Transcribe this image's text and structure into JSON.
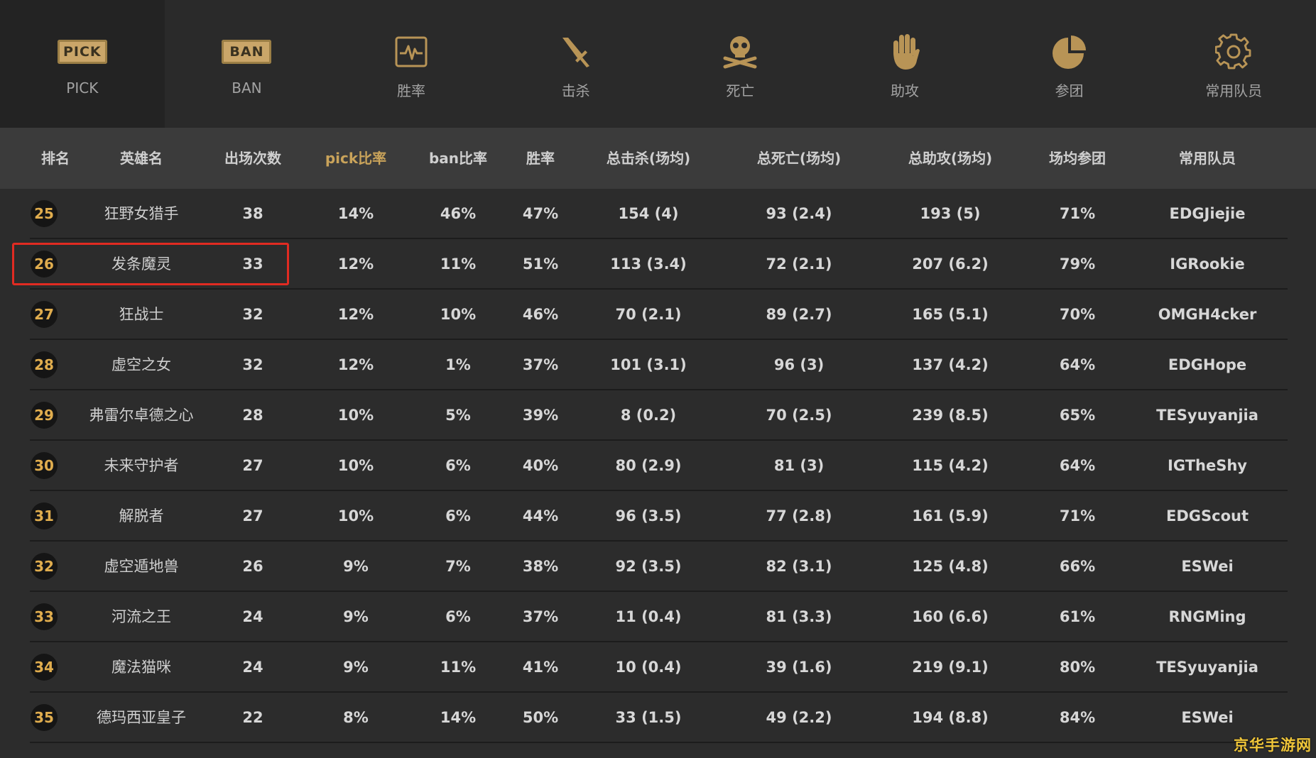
{
  "tabs": [
    {
      "label": "PICK",
      "icon": "pick-badge-icon",
      "badge": "PICK"
    },
    {
      "label": "BAN",
      "icon": "ban-badge-icon",
      "badge": "BAN"
    },
    {
      "label": "胜率",
      "icon": "pulse-chart-icon"
    },
    {
      "label": "击杀",
      "icon": "sword-icon"
    },
    {
      "label": "死亡",
      "icon": "skull-crossbones-icon"
    },
    {
      "label": "助攻",
      "icon": "hand-icon"
    },
    {
      "label": "参团",
      "icon": "pie-chart-icon"
    },
    {
      "label": "常用队员",
      "icon": "gear-icon"
    }
  ],
  "accent_color": "#c9a35a",
  "rank_color": "#e0ad4e",
  "highlight_color": "#e12b22",
  "columns": [
    "排名",
    "英雄名",
    "出场次数",
    "pick比率",
    "ban比率",
    "胜率",
    "总击杀(场均)",
    "总死亡(场均)",
    "总助攻(场均)",
    "场均参团",
    "常用队员"
  ],
  "rows": [
    {
      "rank": "25",
      "hero": "狂野女猎手",
      "games": "38",
      "pick": "14%",
      "ban": "46%",
      "win": "47%",
      "kills": "154 (4)",
      "deaths": "93 (2.4)",
      "assists": "193 (5)",
      "kp": "71%",
      "player": "EDGJiejie"
    },
    {
      "rank": "26",
      "hero": "发条魔灵",
      "games": "33",
      "pick": "12%",
      "ban": "11%",
      "win": "51%",
      "kills": "113 (3.4)",
      "deaths": "72 (2.1)",
      "assists": "207 (6.2)",
      "kp": "79%",
      "player": "IGRookie"
    },
    {
      "rank": "27",
      "hero": "狂战士",
      "games": "32",
      "pick": "12%",
      "ban": "10%",
      "win": "46%",
      "kills": "70 (2.1)",
      "deaths": "89 (2.7)",
      "assists": "165 (5.1)",
      "kp": "70%",
      "player": "OMGH4cker"
    },
    {
      "rank": "28",
      "hero": "虚空之女",
      "games": "32",
      "pick": "12%",
      "ban": "1%",
      "win": "37%",
      "kills": "101 (3.1)",
      "deaths": "96 (3)",
      "assists": "137 (4.2)",
      "kp": "64%",
      "player": "EDGHope"
    },
    {
      "rank": "29",
      "hero": "弗雷尔卓德之心",
      "games": "28",
      "pick": "10%",
      "ban": "5%",
      "win": "39%",
      "kills": "8 (0.2)",
      "deaths": "70 (2.5)",
      "assists": "239 (8.5)",
      "kp": "65%",
      "player": "TESyuyanjia"
    },
    {
      "rank": "30",
      "hero": "未来守护者",
      "games": "27",
      "pick": "10%",
      "ban": "6%",
      "win": "40%",
      "kills": "80 (2.9)",
      "deaths": "81 (3)",
      "assists": "115 (4.2)",
      "kp": "64%",
      "player": "IGTheShy"
    },
    {
      "rank": "31",
      "hero": "解脱者",
      "games": "27",
      "pick": "10%",
      "ban": "6%",
      "win": "44%",
      "kills": "96 (3.5)",
      "deaths": "77 (2.8)",
      "assists": "161 (5.9)",
      "kp": "71%",
      "player": "EDGScout"
    },
    {
      "rank": "32",
      "hero": "虚空遁地兽",
      "games": "26",
      "pick": "9%",
      "ban": "7%",
      "win": "38%",
      "kills": "92 (3.5)",
      "deaths": "82 (3.1)",
      "assists": "125 (4.8)",
      "kp": "66%",
      "player": "ESWei"
    },
    {
      "rank": "33",
      "hero": "河流之王",
      "games": "24",
      "pick": "9%",
      "ban": "6%",
      "win": "37%",
      "kills": "11 (0.4)",
      "deaths": "81 (3.3)",
      "assists": "160 (6.6)",
      "kp": "61%",
      "player": "RNGMing"
    },
    {
      "rank": "34",
      "hero": "魔法猫咪",
      "games": "24",
      "pick": "9%",
      "ban": "11%",
      "win": "41%",
      "kills": "10 (0.4)",
      "deaths": "39 (1.6)",
      "assists": "219 (9.1)",
      "kp": "80%",
      "player": "TESyuyanjia"
    },
    {
      "rank": "35",
      "hero": "德玛西亚皇子",
      "games": "22",
      "pick": "8%",
      "ban": "14%",
      "win": "50%",
      "kills": "33 (1.5)",
      "deaths": "49 (2.2)",
      "assists": "194 (8.8)",
      "kp": "84%",
      "player": "ESWei"
    }
  ],
  "watermark": "京华手游网"
}
